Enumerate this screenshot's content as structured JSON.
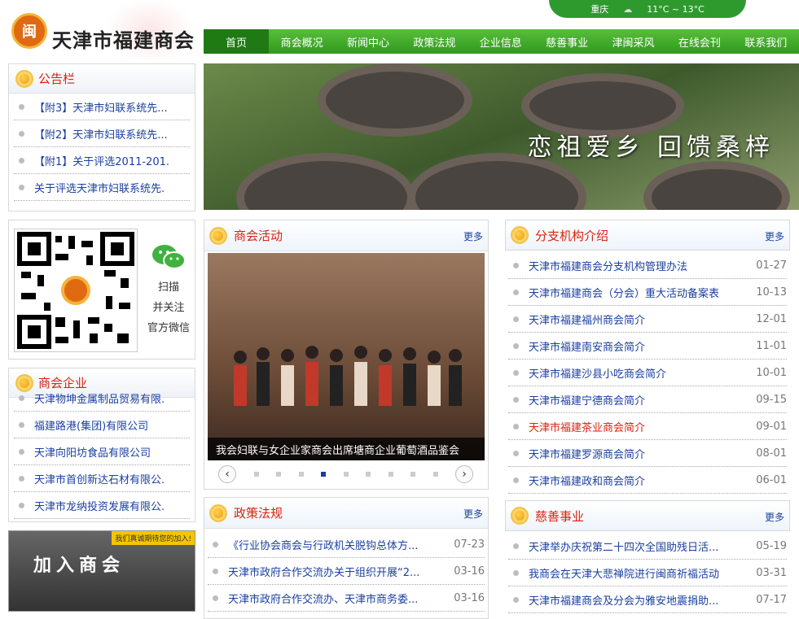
{
  "logo": {
    "name": "天津市福建商会",
    "seal": "闽"
  },
  "weather": {
    "city": "重庆",
    "temp": "11°C ~ 13°C"
  },
  "nav": [
    "首页",
    "商会概况",
    "新闻中心",
    "政策法规",
    "企业信息",
    "慈善事业",
    "津闽采风",
    "在线会刊",
    "联系我们"
  ],
  "banner": {
    "slogan": "恋祖爱乡 回馈桑梓"
  },
  "notice": {
    "title": "公告栏",
    "items": [
      "【附3】天津市妇联系统先...",
      "【附2】天津市妇联系统先...",
      "【附1】关于评选2011-201.",
      "关于评选天津市妇联系统先."
    ]
  },
  "qrcode": {
    "lines": [
      "扫描",
      "并关注",
      "官方微信"
    ]
  },
  "enterprises": {
    "title": "商会企业",
    "items": [
      "天津物坤金属制品贸易有限.",
      "福建路港(集团)有限公司",
      "天津向阳坊食品有限公司",
      "天津市首创新达石材有限公.",
      "天津市龙纳投资发展有限公."
    ]
  },
  "join": {
    "tag": "我们真诚期待您的加入!",
    "label": "加入商会"
  },
  "activity": {
    "title": "商会活动",
    "more": "更多",
    "caption": "我会妇联与女企业家商会出席塘商企业葡萄酒品鉴会"
  },
  "slider": {
    "prev": "‹",
    "next": "›",
    "active": 4,
    "count": 9
  },
  "policy": {
    "title": "政策法规",
    "more": "更多",
    "items": [
      {
        "title": "《行业协会商会与行政机关脱钩总体方...",
        "date": "07-23"
      },
      {
        "title": "天津市政府合作交流办关于组织开展“2...",
        "date": "03-16"
      },
      {
        "title": "天津市政府合作交流办、天津市商务委...",
        "date": "03-16"
      }
    ]
  },
  "branch": {
    "title": "分支机构介绍",
    "more": "更多",
    "items": [
      {
        "title": "天津市福建商会分支机构管理办法",
        "date": "01-27"
      },
      {
        "title": "天津市福建商会（分会）重大活动备案表",
        "date": "10-13"
      },
      {
        "title": "天津市福建福州商会简介",
        "date": "12-01"
      },
      {
        "title": "天津市福建南安商会简介",
        "date": "11-01"
      },
      {
        "title": "天津市福建沙县小吃商会简介",
        "date": "10-01"
      },
      {
        "title": "天津市福建宁德商会简介",
        "date": "09-15"
      },
      {
        "title": "天津市福建茶业商会简介",
        "date": "09-01",
        "highlight": true
      },
      {
        "title": "天津市福建罗源商会简介",
        "date": "08-01"
      },
      {
        "title": "天津市福建政和商会简介",
        "date": "06-01"
      }
    ]
  },
  "charity": {
    "title": "慈善事业",
    "more": "更多",
    "items": [
      {
        "title": "天津举办庆祝第二十四次全国助残日活...",
        "date": "05-19"
      },
      {
        "title": "我商会在天津大悲禅院进行闽商祈福活动",
        "date": "03-31"
      },
      {
        "title": "天津市福建商会及分会为雅安地震捐助...",
        "date": "07-17"
      }
    ]
  }
}
